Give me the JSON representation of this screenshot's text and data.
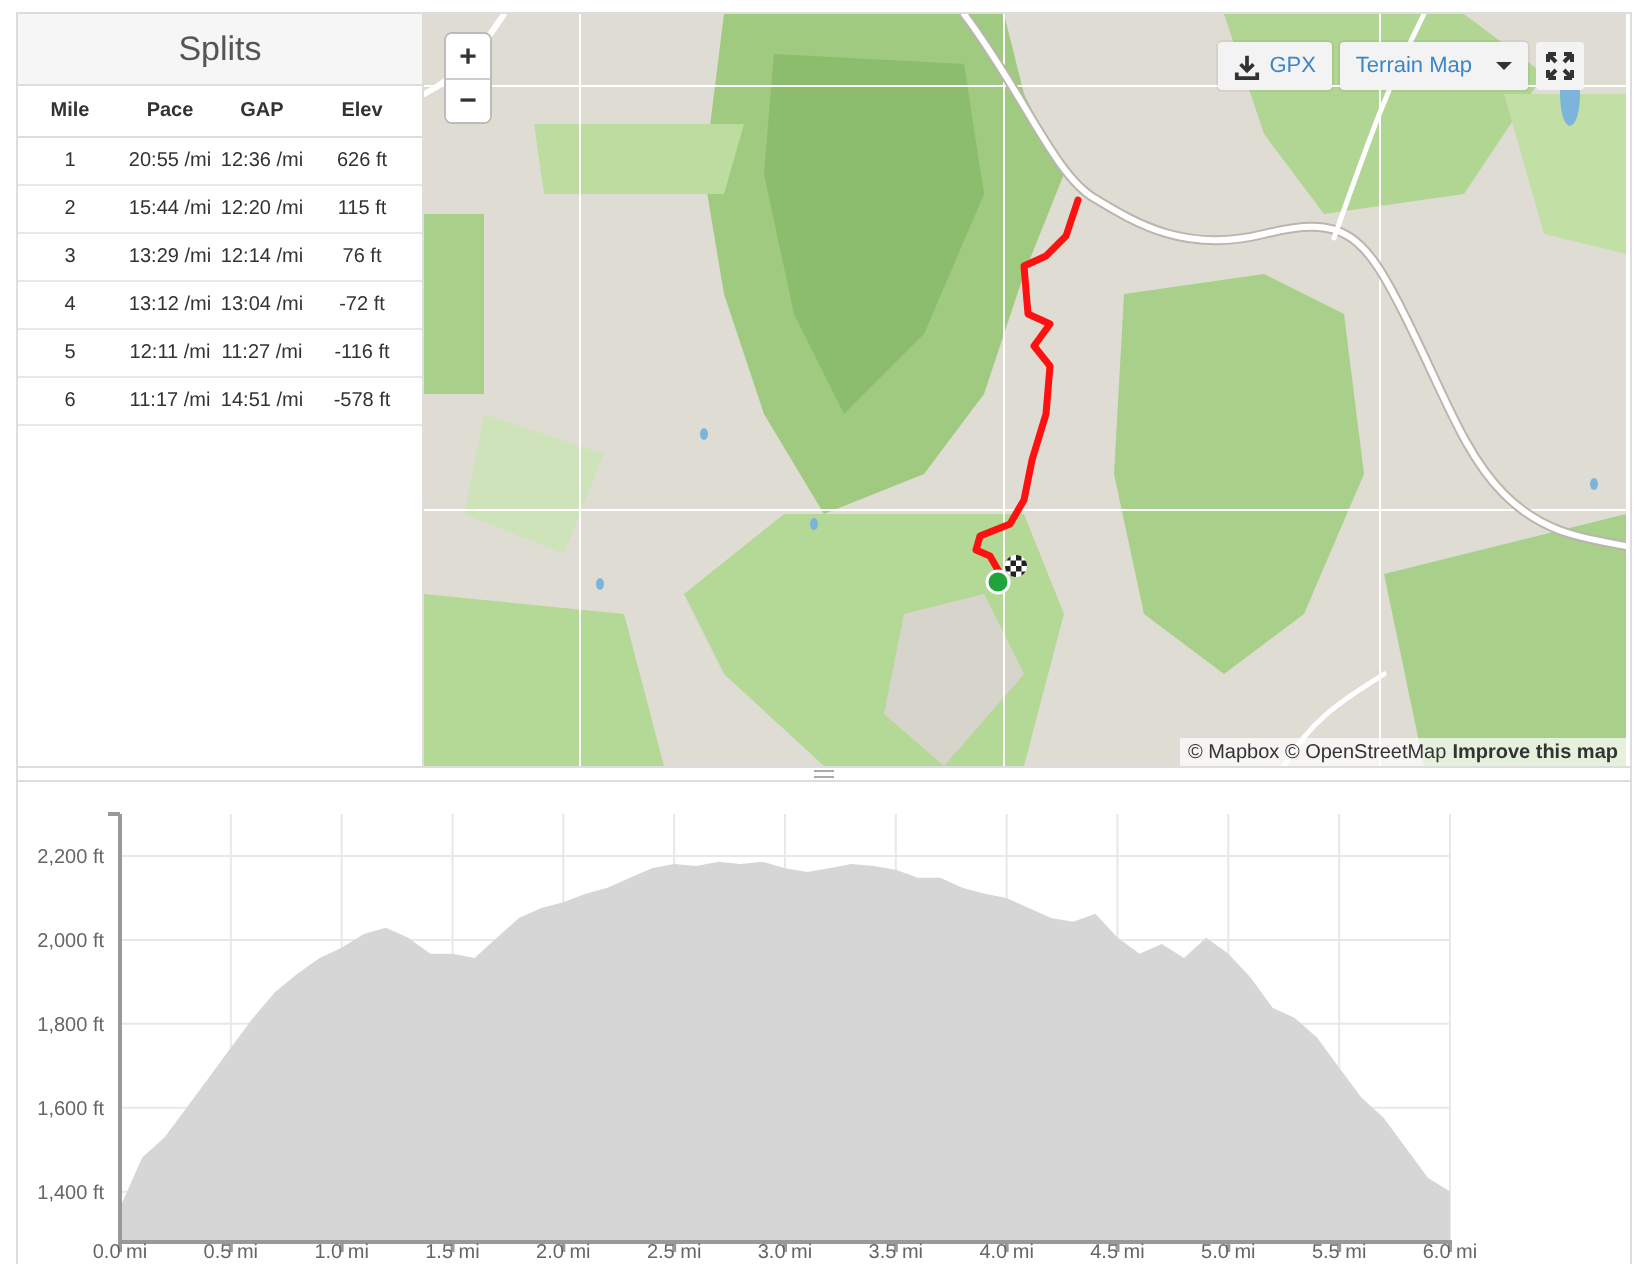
{
  "splits": {
    "title": "Splits",
    "columns": [
      "Mile",
      "Pace",
      "GAP",
      "Elev"
    ],
    "rows": [
      [
        "1",
        "20:55 /mi",
        "12:36 /mi",
        "626 ft"
      ],
      [
        "2",
        "15:44 /mi",
        "12:20 /mi",
        "115 ft"
      ],
      [
        "3",
        "13:29 /mi",
        "12:14 /mi",
        "76 ft"
      ],
      [
        "4",
        "13:12 /mi",
        "13:04 /mi",
        "-72 ft"
      ],
      [
        "5",
        "12:11 /mi",
        "11:27 /mi",
        "-116 ft"
      ],
      [
        "6",
        "11:17 /mi",
        "14:51 /mi",
        "-578 ft"
      ]
    ]
  },
  "map": {
    "zoom_controls": [
      "+",
      "−"
    ],
    "gpx_button": "GPX",
    "style_dropdown": "Terrain Map",
    "attribution": "© Mapbox © OpenStreetMap",
    "improve_link": "Improve this map"
  },
  "elevation_profile": {
    "chart_data": {
      "type": "area",
      "grid": true,
      "x": [
        0,
        0.1,
        0.2,
        0.3,
        0.4,
        0.5,
        0.6,
        0.7,
        0.8,
        0.9,
        1.0,
        1.1,
        1.2,
        1.3,
        1.4,
        1.5,
        1.6,
        1.7,
        1.8,
        1.9,
        2.0,
        2.1,
        2.2,
        2.3,
        2.4,
        2.5,
        2.6,
        2.7,
        2.8,
        2.9,
        3.0,
        3.1,
        3.2,
        3.3,
        3.4,
        3.5,
        3.6,
        3.7,
        3.8,
        3.9,
        4.0,
        4.1,
        4.2,
        4.3,
        4.4,
        4.5,
        4.6,
        4.7,
        4.8,
        4.9,
        5.0,
        5.1,
        5.2,
        5.3,
        5.4,
        5.5,
        5.6,
        5.7,
        5.8,
        5.9,
        6.0
      ],
      "series": [
        {
          "color": "#d6d6d6",
          "values": [
            1362,
            1481,
            1529,
            1600,
            1671,
            1743,
            1814,
            1876,
            1919,
            1957,
            1981,
            2014,
            2029,
            2005,
            1967,
            1967,
            1957,
            2005,
            2052,
            2076,
            2090,
            2110,
            2124,
            2148,
            2171,
            2181,
            2176,
            2186,
            2181,
            2186,
            2171,
            2162,
            2171,
            2181,
            2176,
            2167,
            2148,
            2148,
            2124,
            2110,
            2100,
            2076,
            2052,
            2043,
            2062,
            2005,
            1967,
            1990,
            1957,
            2005,
            1967,
            1910,
            1838,
            1814,
            1767,
            1695,
            1624,
            1576,
            1505,
            1433,
            1400
          ]
        }
      ],
      "xlim": [
        0,
        6
      ],
      "ylim": [
        1280,
        2300
      ],
      "xticks": [
        {
          "value": 0,
          "label": "0.0 mi"
        },
        {
          "value": 0.5,
          "label": "0.5 mi"
        },
        {
          "value": 1,
          "label": "1.0 mi"
        },
        {
          "value": 1.5,
          "label": "1.5 mi"
        },
        {
          "value": 2,
          "label": "2.0 mi"
        },
        {
          "value": 2.5,
          "label": "2.5 mi"
        },
        {
          "value": 3,
          "label": "3.0 mi"
        },
        {
          "value": 3.5,
          "label": "3.5 mi"
        },
        {
          "value": 4,
          "label": "4.0 mi"
        },
        {
          "value": 4.5,
          "label": "4.5 mi"
        },
        {
          "value": 5,
          "label": "5.0 mi"
        },
        {
          "value": 5.5,
          "label": "5.5 mi"
        },
        {
          "value": 6,
          "label": "6.0 mi"
        }
      ],
      "yticks": [
        {
          "value": 1400,
          "label": "1,400 ft"
        },
        {
          "value": 1600,
          "label": "1,600 ft"
        },
        {
          "value": 1800,
          "label": "1,800 ft"
        },
        {
          "value": 2000,
          "label": "2,000 ft"
        },
        {
          "value": 2200,
          "label": "2,200 ft"
        }
      ]
    }
  }
}
